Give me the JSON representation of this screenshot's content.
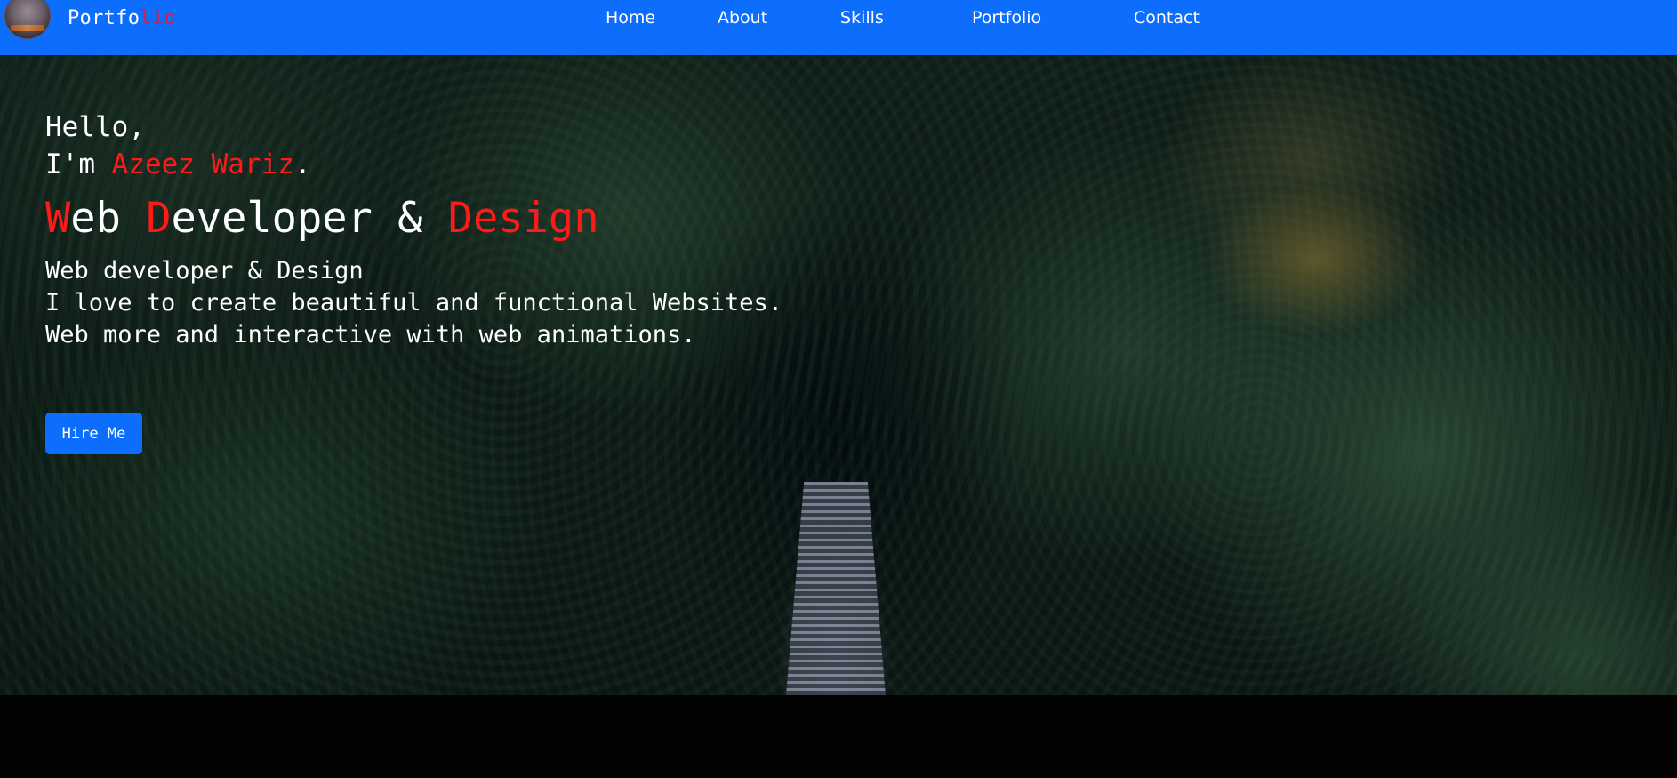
{
  "navbar": {
    "brand_main": "Portfo",
    "brand_accent": "lio",
    "links": [
      "Home",
      "About",
      "Skills",
      "Portfolio",
      "Contact"
    ]
  },
  "hero": {
    "greeting_line1": "Hello,",
    "greeting_prefix": "I'm ",
    "name": "Azeez Wariz",
    "greeting_suffix": ".",
    "headline_parts": [
      {
        "text": "W",
        "color": "red"
      },
      {
        "text": "eb ",
        "color": "white"
      },
      {
        "text": "D",
        "color": "red"
      },
      {
        "text": "eveloper & ",
        "color": "white"
      },
      {
        "text": "Design",
        "color": "red"
      }
    ],
    "description": [
      "Web developer & Design",
      "I love to create beautiful and functional Websites.",
      "Web more and interactive with web animations."
    ],
    "cta_label": "Hire Me"
  },
  "colors": {
    "navbar_bg": "#0d6efd",
    "accent_red": "#ff1a1a",
    "brand_accent": "#e01b3c",
    "page_bg": "#030303"
  },
  "icons": {
    "avatar": "profile-avatar-image"
  }
}
